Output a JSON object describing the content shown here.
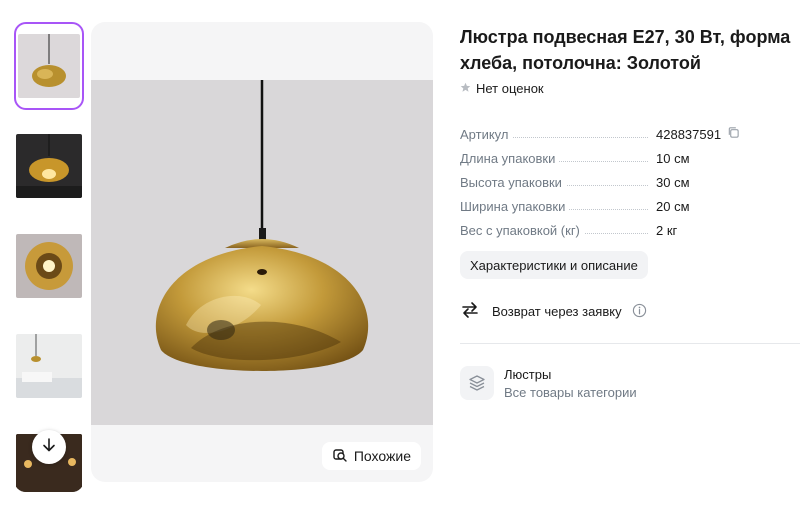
{
  "product": {
    "title": "Люстра подвесная E27, 30 Вт, форма хлеба, потолочна: Золотой",
    "rating_text": "Нет оценок"
  },
  "specs": [
    {
      "key": "Артикул",
      "value": "428837591"
    },
    {
      "key": "Длина упаковки",
      "value": "10 см"
    },
    {
      "key": "Высота упаковки",
      "value": "30 см"
    },
    {
      "key": "Ширина упаковки",
      "value": "20 см"
    },
    {
      "key": "Вес с упаковкой (кг)",
      "value": "2 кг"
    }
  ],
  "buttons": {
    "characteristics": "Характеристики и описание",
    "similar": "Похожие"
  },
  "return_policy": {
    "label": "Возврат через заявку"
  },
  "category": {
    "name": "Люстры",
    "all_link": "Все товары категории"
  },
  "icons": {
    "star": "star-icon",
    "copy": "copy-icon",
    "return": "swap-arrows-icon",
    "info": "info-icon",
    "category": "layers-icon",
    "similar": "similar-search-icon",
    "scroll": "arrow-down-icon"
  },
  "colors": {
    "selected_border": "#a855f7",
    "muted_text": "#707a85",
    "star": "#b8bcc2"
  }
}
